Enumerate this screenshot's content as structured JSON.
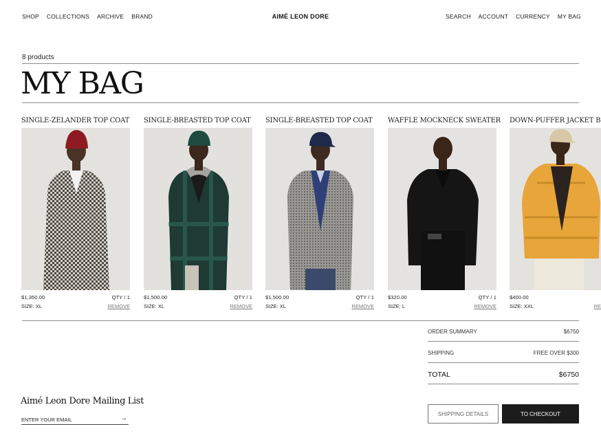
{
  "nav_left": [
    "SHOP",
    "COLLECTIONS",
    "ARCHIVE",
    "BRAND"
  ],
  "brand": "AIMÉ LEON DORE",
  "nav_right": [
    "SEARCH",
    "ACCOUNT",
    "CURRENCY",
    "MY BAG"
  ],
  "bag": {
    "count": "8 products",
    "title": "MY BAG"
  },
  "products": [
    {
      "name": "SINGLE-ZELANDER TOP COAT",
      "price": "$1,350.00",
      "qty": "QTY / 1",
      "size": "SIZE: XL",
      "remove": "REMOVE"
    },
    {
      "name": "SINGLE-BREASTED TOP COAT",
      "price": "$1,500.00",
      "qty": "QTY / 1",
      "size": "SIZE: XL",
      "remove": "REMOVE"
    },
    {
      "name": "SINGLE-BREASTED TOP COAT",
      "price": "$1,500.00",
      "qty": "QTY / 1",
      "size": "SIZE: XL",
      "remove": "REMOVE"
    },
    {
      "name": "WAFFLE MOCKNECK SWEATER",
      "price": "$320.00",
      "qty": "QTY / 1",
      "size": "SIZE: L",
      "remove": "REMOVE"
    },
    {
      "name": "DOWN-PUFFER JACKET B",
      "price": "$400.00",
      "qty": "",
      "size": "SIZE: XXL",
      "remove": "RE"
    }
  ],
  "summary": {
    "order_label": "ORDER SUMMARY",
    "order_value": "$6750",
    "shipping_label": "SHIPPING",
    "shipping_value": "FREE OVER $300",
    "total_label": "TOTAL",
    "total_value": "$6750"
  },
  "buttons": {
    "shipping": "SHIPPING DETAILS",
    "checkout": "TO CHECKOUT"
  },
  "mailing": {
    "title": "Aimé Leon Dore Mailing List",
    "placeholder": "ENTER YOUR EMAIL"
  },
  "colors": {
    "accent_dark": "#1c1c1c",
    "rule": "#8c8c8c",
    "photo_bg": "#e2e0dd"
  }
}
